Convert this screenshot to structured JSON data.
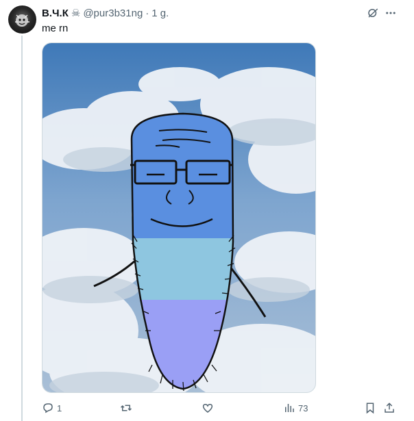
{
  "author": {
    "display_name": "В.Ч.К",
    "name_emoji": "☠",
    "handle": "@pur3b31ng",
    "separator": "·",
    "time": "1 g."
  },
  "tweet": {
    "text": "me rn"
  },
  "media": {
    "description_icon": "meme-image"
  },
  "actions": {
    "replies": "1",
    "retweets": "",
    "likes": "",
    "views": "73"
  },
  "icons": {
    "header": [
      "grok-icon",
      "more-icon"
    ],
    "actions": [
      "reply-icon",
      "retweet-icon",
      "like-icon",
      "views-icon",
      "bookmark-icon",
      "share-icon"
    ]
  },
  "colors": {
    "text": "#0f1419",
    "muted": "#536471",
    "border": "#cfd9de"
  }
}
